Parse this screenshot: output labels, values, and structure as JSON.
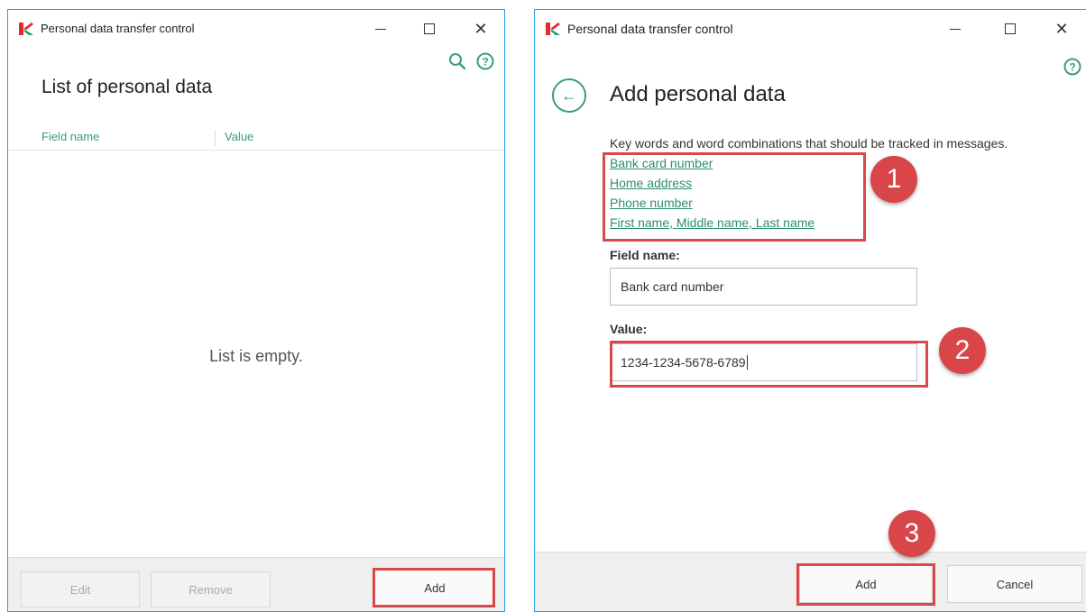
{
  "left_window": {
    "title": "Personal data transfer control",
    "header": "List of personal data",
    "columns": [
      "Field name",
      "Value"
    ],
    "empty_text": "List is empty.",
    "buttons": {
      "edit": "Edit",
      "remove": "Remove",
      "add": "Add"
    },
    "icons": [
      "kaspersky-logo-icon",
      "minimize-icon",
      "maximize-icon",
      "close-icon",
      "search-icon",
      "help-icon"
    ]
  },
  "right_window": {
    "title": "Personal data transfer control",
    "header": "Add personal data",
    "description": "Key words and word combinations that should be tracked in messages.",
    "links": [
      "Bank card number",
      "Home address",
      "Phone number",
      "First name, Middle name, Last name"
    ],
    "field_name_label": "Field name:",
    "field_name_value": "Bank card number",
    "value_label": "Value:",
    "value_value": "1234-1234-5678-6789",
    "buttons": {
      "add": "Add",
      "cancel": "Cancel"
    },
    "icons": [
      "kaspersky-logo-icon",
      "minimize-icon",
      "maximize-icon",
      "close-icon",
      "help-icon",
      "back-arrow-icon"
    ]
  },
  "annotations": {
    "badge1": "1",
    "badge2": "2",
    "badge3": "3"
  },
  "colors": {
    "accent": "#3a9e7d",
    "border": "#2a9fe0",
    "highlight": "#d9484b"
  }
}
